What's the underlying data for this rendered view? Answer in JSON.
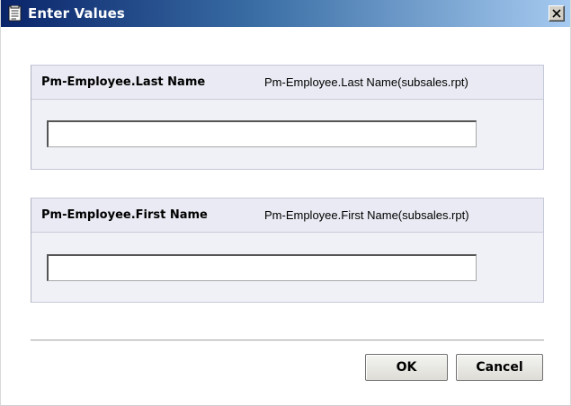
{
  "window": {
    "title": "Enter Values"
  },
  "parameters": [
    {
      "name": "Pm-Employee.Last Name",
      "description": "Pm-Employee.Last Name(subsales.rpt)",
      "value": "",
      "placeholder": ""
    },
    {
      "name": "Pm-Employee.First Name",
      "description": "Pm-Employee.First Name(subsales.rpt)",
      "value": "",
      "placeholder": ""
    }
  ],
  "buttons": {
    "ok_label": "OK",
    "cancel_label": "Cancel"
  },
  "icons": {
    "title": "document-icon",
    "close": "close-icon"
  },
  "colors": {
    "titlebar_start": "#0a246a",
    "titlebar_end": "#a6caf0",
    "section_bg": "#f0f1f7",
    "section_header_bg": "#e9eaf3"
  }
}
